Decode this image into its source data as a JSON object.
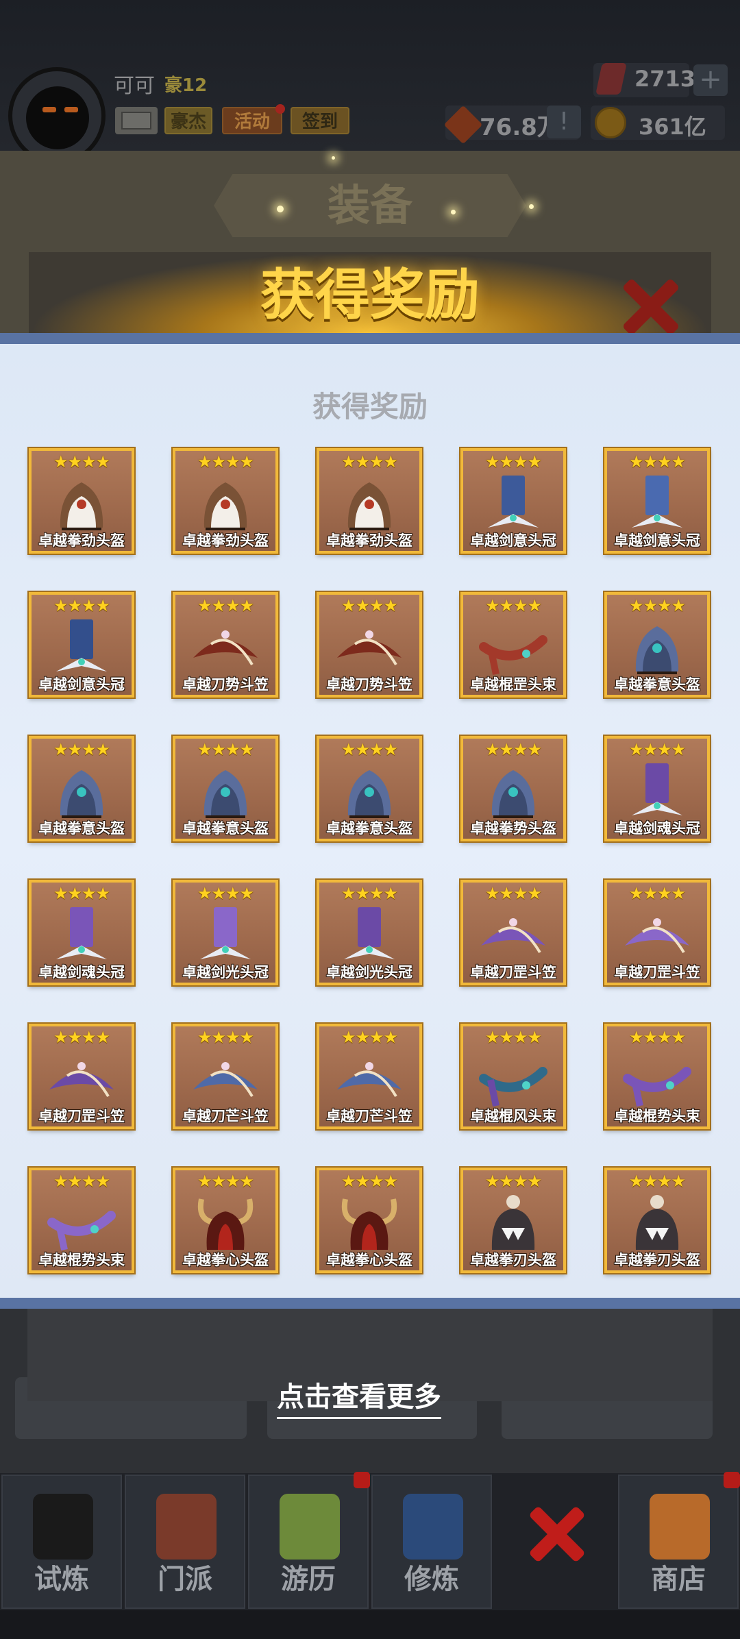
{
  "player": {
    "name": "可可",
    "rank": "豪12"
  },
  "hud_buttons": {
    "haojie": "豪杰",
    "huodong": "活动",
    "qiandao": "签到"
  },
  "currency": {
    "gems": "2713",
    "plus": "+",
    "power": "76.8万",
    "warn": "!",
    "coins": "361亿"
  },
  "background": {
    "panel_title": "装备"
  },
  "reward_banner": {
    "title": "获得奖励"
  },
  "modal": {
    "title": "获得奖励",
    "items": [
      {
        "stars": "★★★★",
        "label": "卓越拳劲头盔",
        "icon": "fist-helmet-icon"
      },
      {
        "stars": "★★★★",
        "label": "卓越拳劲头盔",
        "icon": "fist-helmet-icon"
      },
      {
        "stars": "★★★★",
        "label": "卓越拳劲头盔",
        "icon": "fist-helmet-icon"
      },
      {
        "stars": "★★★★",
        "label": "卓越剑意头冠",
        "icon": "sword-crown-icon"
      },
      {
        "stars": "★★★★",
        "label": "卓越剑意头冠",
        "icon": "sword-crown-icon"
      },
      {
        "stars": "★★★★",
        "label": "卓越剑意头冠",
        "icon": "sword-crown-icon"
      },
      {
        "stars": "★★★★",
        "label": "卓越刀势斗笠",
        "icon": "bamboo-hat-icon"
      },
      {
        "stars": "★★★★",
        "label": "卓越刀势斗笠",
        "icon": "bamboo-hat-icon"
      },
      {
        "stars": "★★★★",
        "label": "卓越棍罡头束",
        "icon": "headband-icon"
      },
      {
        "stars": "★★★★",
        "label": "卓越拳意头盔",
        "icon": "fist-helmet-icon"
      },
      {
        "stars": "★★★★",
        "label": "卓越拳意头盔",
        "icon": "fist-helmet-icon"
      },
      {
        "stars": "★★★★",
        "label": "卓越拳意头盔",
        "icon": "fist-helmet-icon"
      },
      {
        "stars": "★★★★",
        "label": "卓越拳意头盔",
        "icon": "fist-helmet-icon"
      },
      {
        "stars": "★★★★",
        "label": "卓越拳势头盔",
        "icon": "fist-helmet-icon"
      },
      {
        "stars": "★★★★",
        "label": "卓越剑魂头冠",
        "icon": "sword-crown-icon"
      },
      {
        "stars": "★★★★",
        "label": "卓越剑魂头冠",
        "icon": "sword-crown-icon"
      },
      {
        "stars": "★★★★",
        "label": "卓越剑光头冠",
        "icon": "sword-crown-icon"
      },
      {
        "stars": "★★★★",
        "label": "卓越剑光头冠",
        "icon": "sword-crown-icon"
      },
      {
        "stars": "★★★★",
        "label": "卓越刀罡斗笠",
        "icon": "bamboo-hat-icon"
      },
      {
        "stars": "★★★★",
        "label": "卓越刀罡斗笠",
        "icon": "bamboo-hat-icon"
      },
      {
        "stars": "★★★★",
        "label": "卓越刀罡斗笠",
        "icon": "bamboo-hat-icon"
      },
      {
        "stars": "★★★★",
        "label": "卓越刀芒斗笠",
        "icon": "bamboo-hat-icon"
      },
      {
        "stars": "★★★★",
        "label": "卓越刀芒斗笠",
        "icon": "bamboo-hat-icon"
      },
      {
        "stars": "★★★★",
        "label": "卓越棍风头束",
        "icon": "headband-icon"
      },
      {
        "stars": "★★★★",
        "label": "卓越棍势头束",
        "icon": "headband-icon"
      },
      {
        "stars": "★★★★",
        "label": "卓越棍势头束",
        "icon": "headband-icon"
      },
      {
        "stars": "★★★★",
        "label": "卓越拳心头盔",
        "icon": "horned-helmet-icon"
      },
      {
        "stars": "★★★★",
        "label": "卓越拳心头盔",
        "icon": "horned-helmet-icon"
      },
      {
        "stars": "★★★★",
        "label": "卓越拳刃头盔",
        "icon": "fanged-helmet-icon"
      },
      {
        "stars": "★★★★",
        "label": "卓越拳刃头盔",
        "icon": "fanged-helmet-icon"
      }
    ]
  },
  "more_link": "点击查看更多",
  "bottom_nav": [
    {
      "label": "试炼",
      "icon": "ninja-icon"
    },
    {
      "label": "门派",
      "icon": "temple-icon"
    },
    {
      "label": "游历",
      "icon": "mountain-icon"
    },
    {
      "label": "修炼",
      "icon": "scroll-book-icon"
    },
    {
      "label": "",
      "icon": "close-icon"
    },
    {
      "label": "商店",
      "icon": "shop-icon"
    }
  ],
  "colors": {
    "modal_border": "#5973a3",
    "item_frame": "#f1b93a",
    "star": "#ffd21f",
    "reward_title": "#ffd54a",
    "close_red": "#c01d1a"
  }
}
